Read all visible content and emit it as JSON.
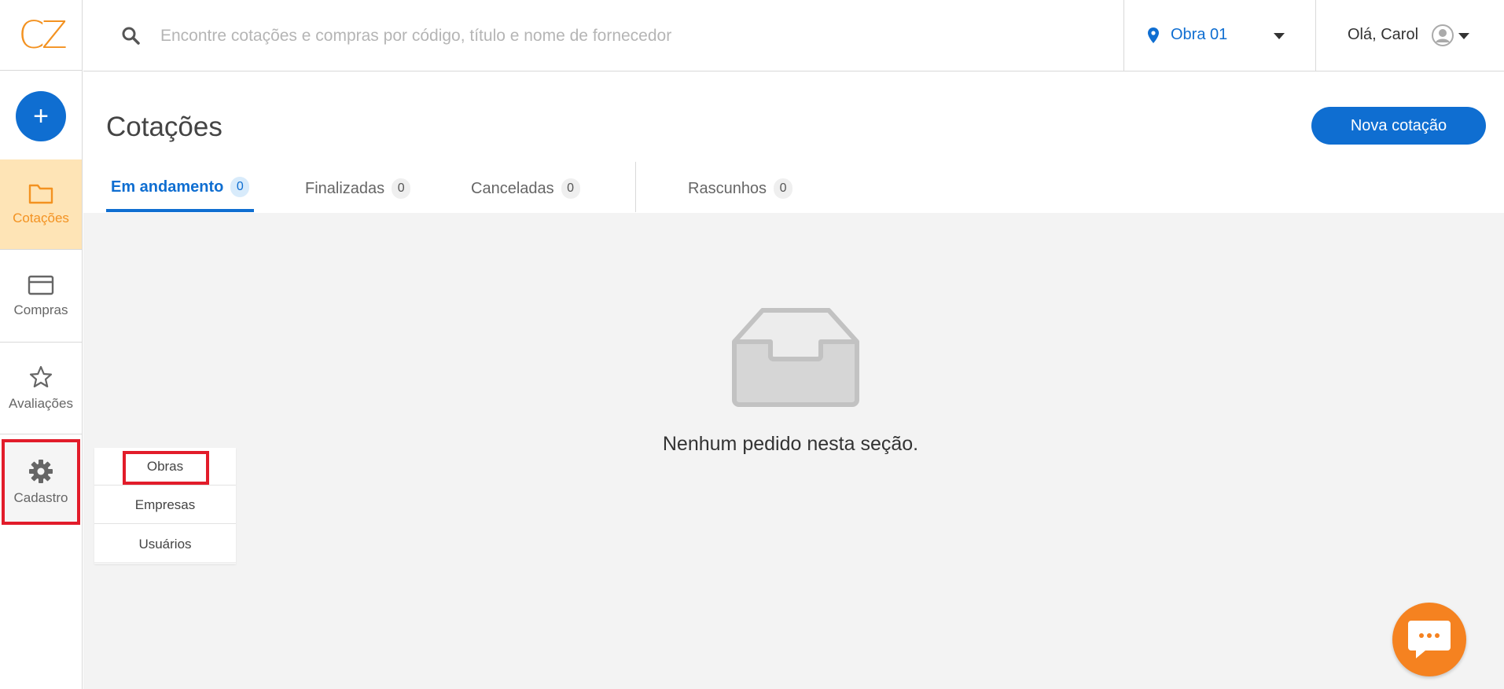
{
  "brand": {
    "logo_text": "CZ",
    "accent": "#f39221",
    "primary": "#0f6ed1"
  },
  "sidebar": {
    "add_button_label": "+",
    "items": [
      {
        "label": "Cotações",
        "icon": "folder-icon",
        "active": true
      },
      {
        "label": "Compras",
        "icon": "credit-card-icon",
        "active": false
      },
      {
        "label": "Avaliações",
        "icon": "star-icon",
        "active": false
      },
      {
        "label": "Cadastro",
        "icon": "gear-icon",
        "active": false
      }
    ]
  },
  "header": {
    "search": {
      "placeholder": "Encontre cotações e compras por código, título e nome de fornecedor",
      "value": ""
    },
    "obra": {
      "label": "Obra 01"
    },
    "user": {
      "greeting": "Olá, Carol"
    }
  },
  "main": {
    "title": "Cotações",
    "new_button_label": "Nova cotação",
    "tabs": [
      {
        "label": "Em andamento",
        "count": "0",
        "active": true
      },
      {
        "label": "Finalizadas",
        "count": "0",
        "active": false
      },
      {
        "label": "Canceladas",
        "count": "0",
        "active": false
      },
      {
        "label": "Rascunhos",
        "count": "0",
        "active": false
      }
    ],
    "empty_message": "Nenhum pedido nesta seção."
  },
  "submenu": {
    "items": [
      {
        "label": "Obras"
      },
      {
        "label": "Empresas"
      },
      {
        "label": "Usuários"
      }
    ]
  },
  "chat": {
    "icon": "chat-bubble-icon"
  }
}
